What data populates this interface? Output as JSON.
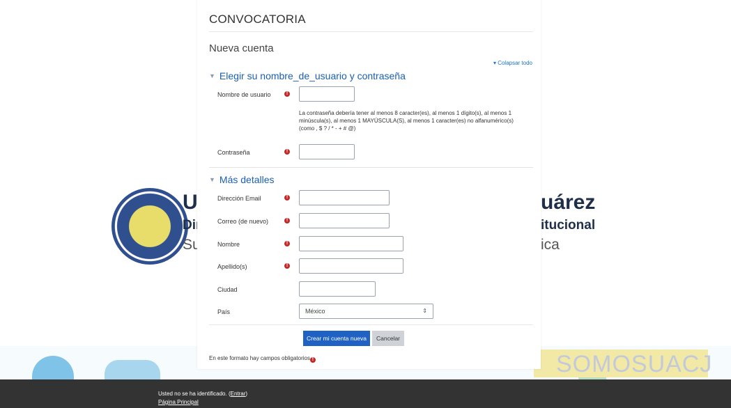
{
  "background": {
    "brand_line1_left": "Un",
    "brand_line1_right": "uárez",
    "brand_line2_left": "Dir",
    "brand_line2_right": "itucional",
    "brand_line3_left": "Sul",
    "brand_line3_right": "ica",
    "banner_right": "SOMOSUACJ"
  },
  "card": {
    "title": "CONVOCATORIA",
    "subtitle": "Nueva cuenta",
    "collapse_all": "Colapsar todo"
  },
  "section_account": {
    "title": "Elegir su nombre_de_usuario y contraseña",
    "username_label": "Nombre de usuario",
    "password_note": "La contraseña debería tener al menos 8 caracter(es), al menos 1 dígito(s), al menos 1 minúscula(s), al menos 1 MAYÚSCULA(S), al menos 1 caracter(es) no alfanumérico(s) (como , $ ? / * - + # @)",
    "password_label": "Contraseña"
  },
  "section_details": {
    "title": "Más detalles",
    "email_label": "Dirección Email",
    "email_again_label": "Correo (de nuevo)",
    "firstname_label": "Nombre",
    "lastname_label": "Apellido(s)",
    "city_label": "Ciudad",
    "country_label": "País",
    "country_value": "México"
  },
  "actions": {
    "submit_label": "Crear mi cuenta nueva",
    "cancel_label": "Cancelar",
    "required_note": "En este formato hay campos obligatorios"
  },
  "icons": {
    "required": "exclamation-circle-icon"
  },
  "colors": {
    "accent": "#1f62c3",
    "required": "#c22a2a",
    "footer_bg": "#333333"
  },
  "footer": {
    "not_logged_prefix": "Usted no se ha identificado. (",
    "login_link": "Entrar",
    "not_logged_suffix": ")",
    "home_link": "Página Principal"
  }
}
